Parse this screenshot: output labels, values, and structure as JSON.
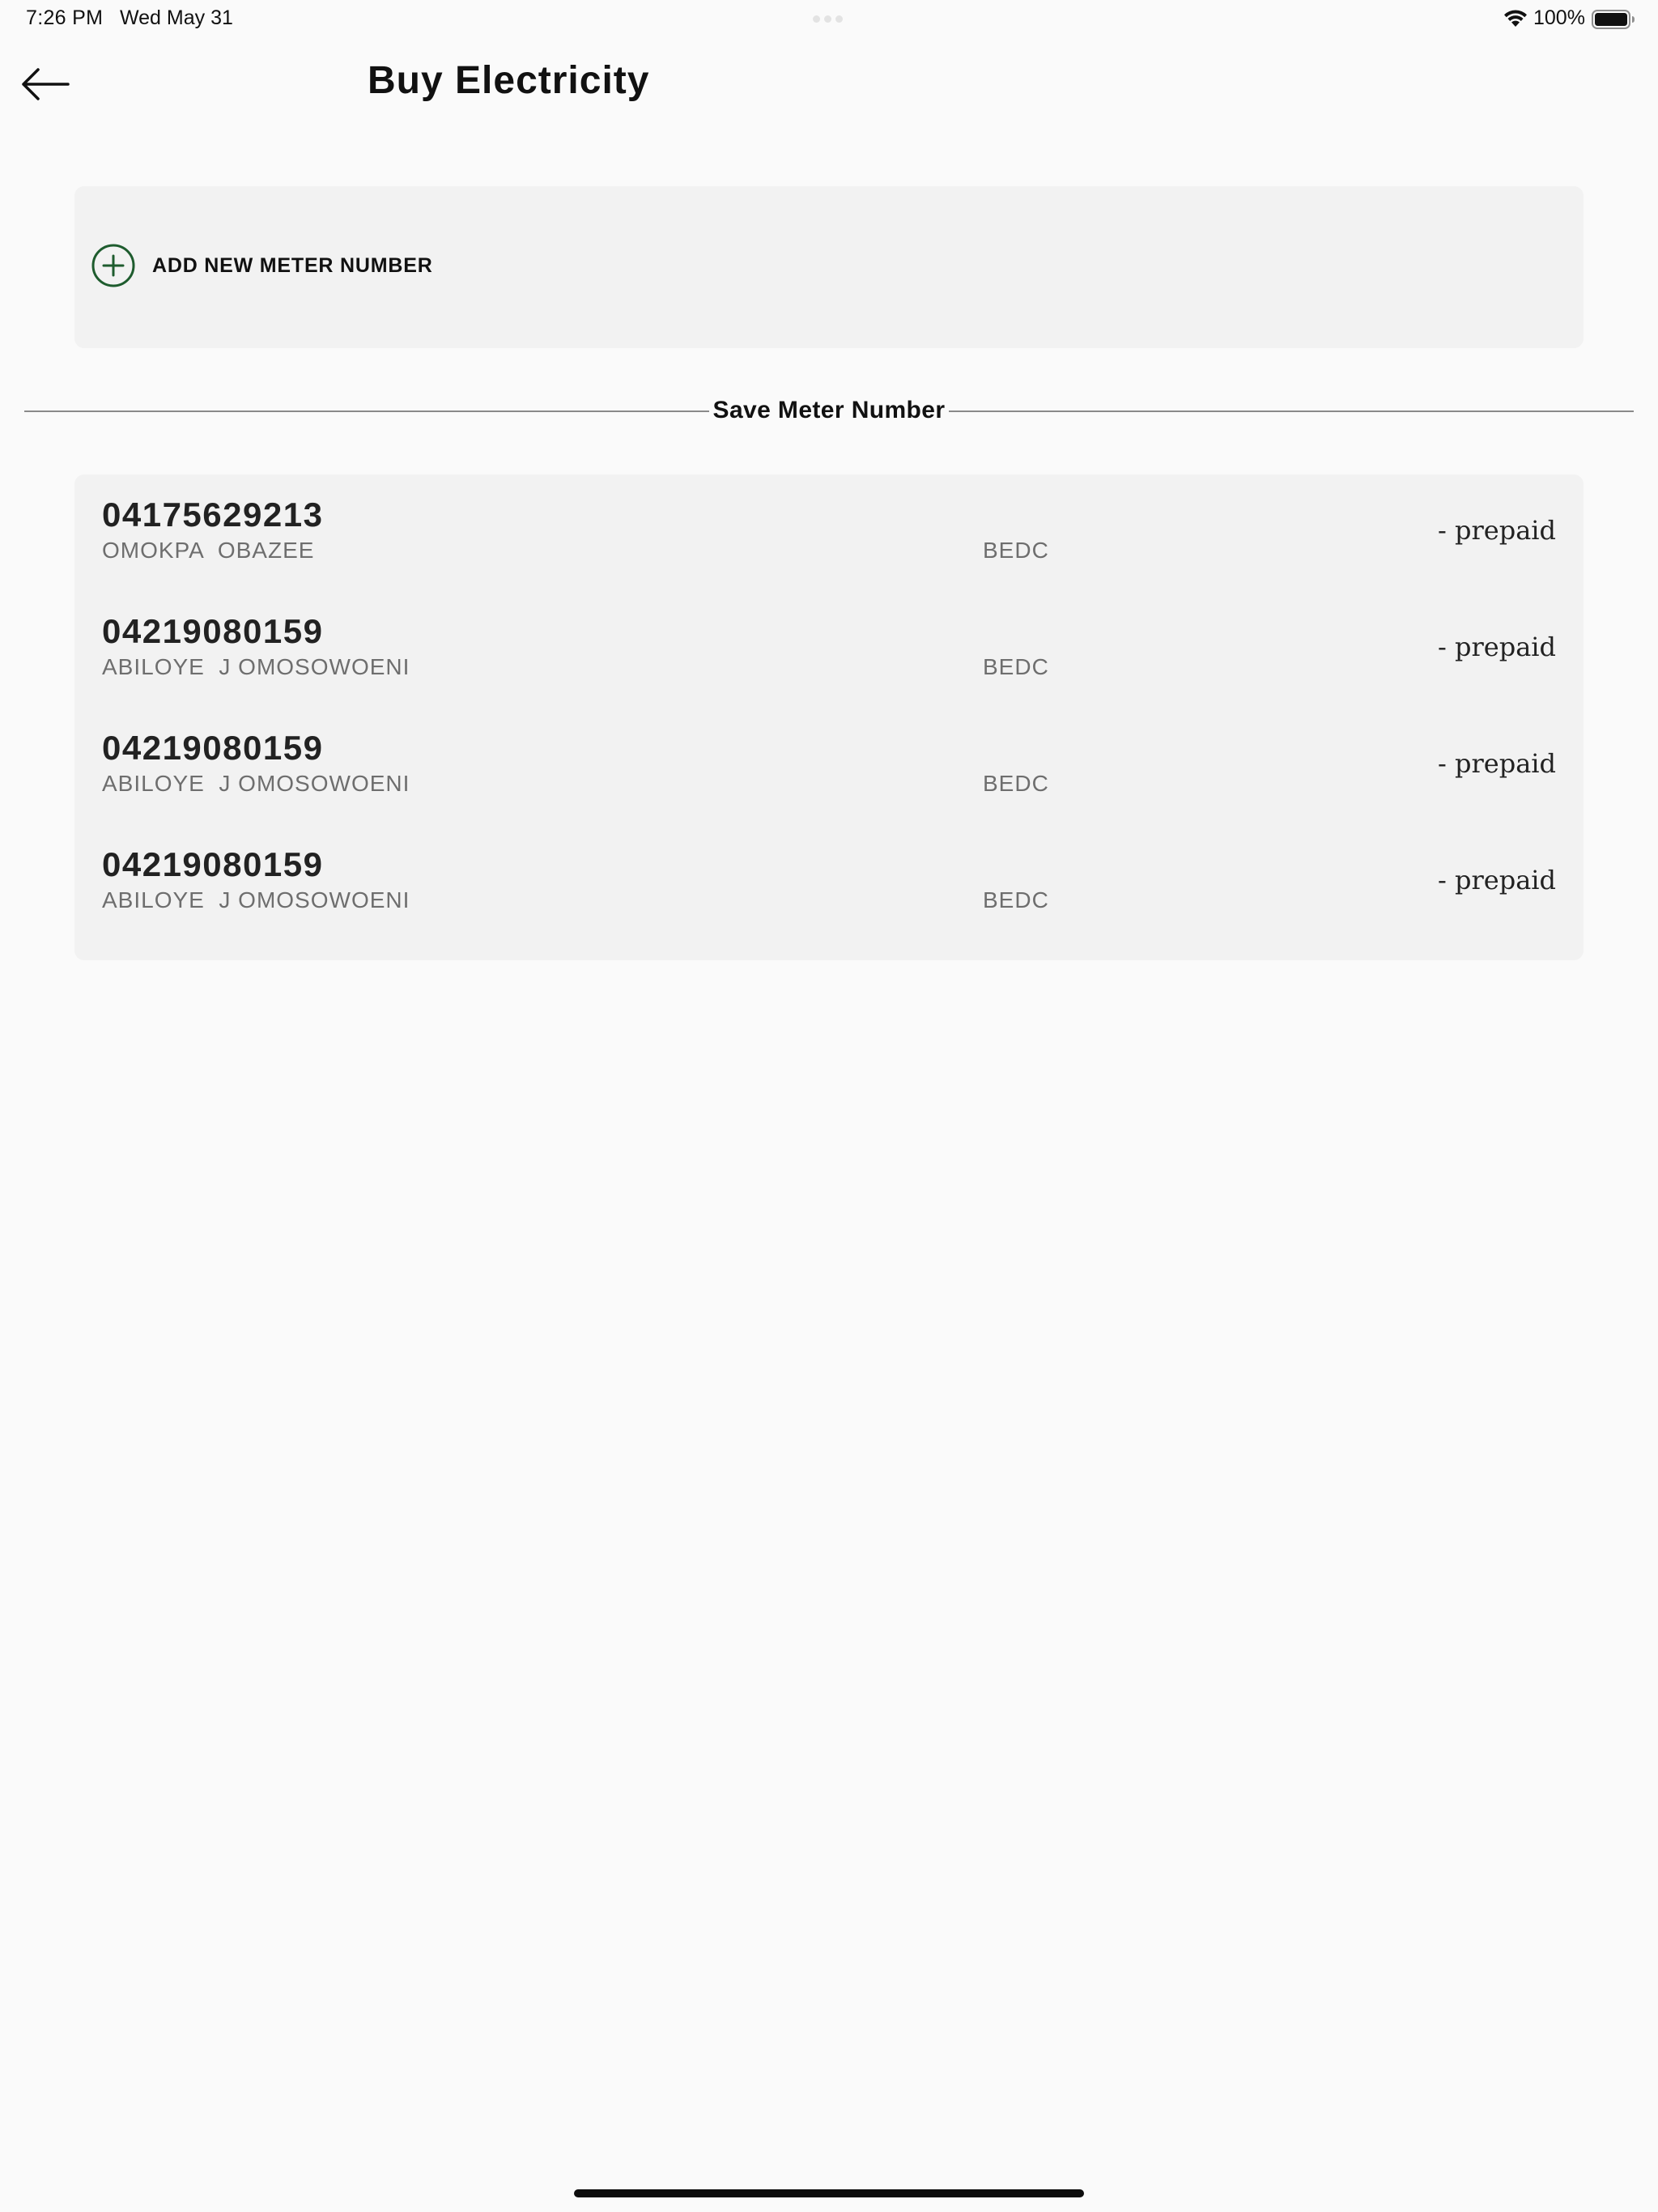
{
  "status_bar": {
    "time": "7:26 PM",
    "date": "Wed May 31",
    "battery_percent": "100%",
    "battery_level": 1.0,
    "wifi_icon": "wifi-icon",
    "battery_icon": "battery-icon"
  },
  "header": {
    "back_icon": "arrow-left-icon",
    "title": "Buy Electricity"
  },
  "add_meter": {
    "icon": "plus-circle-icon",
    "label": "ADD NEW METER NUMBER",
    "accent_color": "#1e5c2e"
  },
  "saved_section": {
    "title": "Save Meter Number"
  },
  "meters": [
    {
      "number": "04175629213",
      "owner": "OMOKPA  OBAZEE",
      "provider": "BEDC",
      "type": "- prepaid"
    },
    {
      "number": "04219080159",
      "owner": "ABILOYE  J OMOSOWOENI",
      "provider": "BEDC",
      "type": "- prepaid"
    },
    {
      "number": "04219080159",
      "owner": "ABILOYE  J OMOSOWOENI",
      "provider": "BEDC",
      "type": "- prepaid"
    },
    {
      "number": "04219080159",
      "owner": "ABILOYE  J OMOSOWOENI",
      "provider": "BEDC",
      "type": "- prepaid"
    }
  ]
}
